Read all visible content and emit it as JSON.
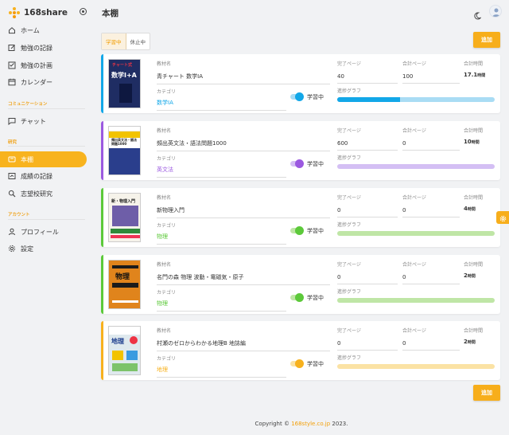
{
  "app": {
    "name": "168share"
  },
  "header": {
    "title": "本棚"
  },
  "sidebar": {
    "items": [
      {
        "label": "ホーム",
        "icon": "home-icon"
      },
      {
        "label": "勉強の記録",
        "icon": "edit-icon"
      },
      {
        "label": "勉強の計画",
        "icon": "checklist-icon"
      },
      {
        "label": "カレンダー",
        "icon": "calendar-icon"
      },
      {
        "label": "チャット",
        "icon": "chat-icon"
      },
      {
        "label": "本棚",
        "icon": "book-icon",
        "active": true
      },
      {
        "label": "成績の記録",
        "icon": "grade-icon"
      },
      {
        "label": "志望校研究",
        "icon": "search-icon"
      },
      {
        "label": "プロフィール",
        "icon": "user-icon"
      },
      {
        "label": "設定",
        "icon": "gear-icon"
      }
    ],
    "sections": {
      "communication": "コミュニケーション",
      "study": "研究",
      "account": "アカウント"
    }
  },
  "tabs": {
    "studying": "学習中",
    "paused": "休止中"
  },
  "add_button": "追加",
  "labels": {
    "material": "教材名",
    "category": "カテゴリ",
    "done_page": "完了ページ",
    "total_page": "合計ページ",
    "total_time": "合計時間",
    "progress_graph": "進捗グラフ",
    "hours_unit": "時間"
  },
  "books": [
    {
      "title": "青チャート 数学IA",
      "category": "数学IA",
      "status": "学習中",
      "done": "40",
      "total": "100",
      "hours": "17.1",
      "progress": 0.4,
      "color": "#12a7e8",
      "track": "#a9dcf4"
    },
    {
      "title": "頻出英文法・語法問題1000",
      "category": "英文法",
      "status": "学習中",
      "done": "600",
      "total": "0",
      "hours": "10",
      "progress": 0,
      "color": "#9b59e0",
      "track": "#d4bff4"
    },
    {
      "title": "新物理入門",
      "category": "物理",
      "status": "学習中",
      "done": "0",
      "total": "0",
      "hours": "4",
      "progress": 0,
      "color": "#5cc93a",
      "track": "#bfe6a6"
    },
    {
      "title": "名門の森 物理 波動・電磁気・原子",
      "category": "物理",
      "status": "学習中",
      "done": "0",
      "total": "0",
      "hours": "2",
      "progress": 0,
      "color": "#5cc93a",
      "track": "#bfe6a6"
    },
    {
      "title": "村瀬のゼロからわかる地理B 地誌編",
      "category": "地理",
      "status": "学習中",
      "done": "0",
      "total": "0",
      "hours": "2",
      "progress": 0,
      "color": "#f7b11e",
      "track": "#fbe2a4"
    }
  ],
  "covers": [
    {
      "brand": "チャート式",
      "title": "数学I+A"
    },
    {
      "brand": "",
      "title": "頻出英文法・語法問題1000"
    },
    {
      "brand": "",
      "title": "新・物理入門"
    },
    {
      "brand": "",
      "title": "物理"
    },
    {
      "brand": "",
      "title": "地理"
    }
  ],
  "footer": {
    "prefix": "Copyright © ",
    "link": "168style.co.jp",
    "suffix": " 2023."
  }
}
